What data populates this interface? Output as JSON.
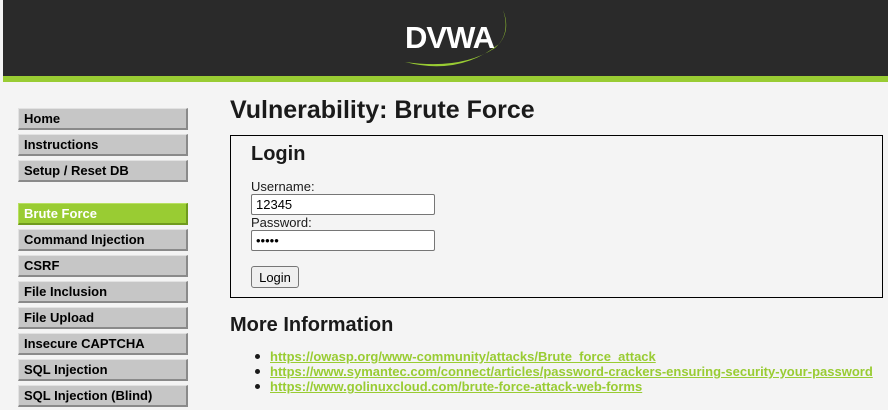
{
  "header": {
    "logo_text": "DVWA"
  },
  "sidebar": {
    "group1": [
      {
        "label": "Home"
      },
      {
        "label": "Instructions"
      },
      {
        "label": "Setup / Reset DB"
      }
    ],
    "group2": [
      {
        "label": "Brute Force",
        "active": true
      },
      {
        "label": "Command Injection"
      },
      {
        "label": "CSRF"
      },
      {
        "label": "File Inclusion"
      },
      {
        "label": "File Upload"
      },
      {
        "label": "Insecure CAPTCHA"
      },
      {
        "label": "SQL Injection"
      },
      {
        "label": "SQL Injection (Blind)"
      }
    ]
  },
  "main": {
    "title": "Vulnerability: Brute Force",
    "login": {
      "heading": "Login",
      "username_label": "Username:",
      "username_value": "12345",
      "password_label": "Password:",
      "password_value": "12345",
      "button_label": "Login"
    },
    "more_info": {
      "heading": "More Information",
      "links": [
        "https://owasp.org/www-community/attacks/Brute_force_attack",
        "https://www.symantec.com/connect/articles/password-crackers-ensuring-security-your-password",
        "https://www.golinuxcloud.com/brute-force-attack-web-forms"
      ]
    }
  },
  "colors": {
    "header_bg": "#2a2a2a",
    "accent": "#99cc33",
    "page_bg": "#f4f4f4",
    "menu_bg": "#c6c6c6"
  }
}
